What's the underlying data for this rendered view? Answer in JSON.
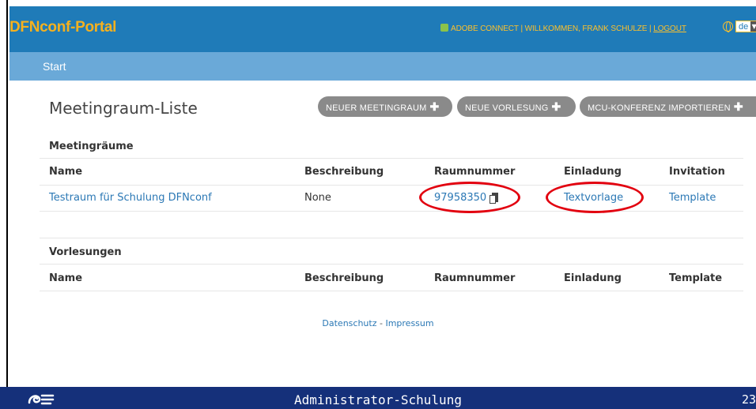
{
  "header": {
    "brand": "DFNconf-Portal",
    "adobe_connect": "ADOBE CONNECT",
    "separator": " | ",
    "welcome": "WILLKOMMEN, FRANK SCHULZE",
    "logout": "LOGOUT",
    "language": "de",
    "colors": {
      "bar": "#1f7bb8",
      "brand": "#f6b11e"
    }
  },
  "subnav": {
    "start": "Start"
  },
  "page": {
    "title": "Meetingraum-Liste",
    "buttons": {
      "new_room": "NEUER MEETINGRAUM",
      "new_lecture": "NEUE VORLESUNG",
      "mcu_import": "MCU-KONFERENZ IMPORTIEREN",
      "plus": "✚"
    }
  },
  "meetingrooms": {
    "title": "Meetingräume",
    "headers": {
      "name": "Name",
      "description": "Beschreibung",
      "room_number": "Raumnummer",
      "invitation": "Einladung",
      "invitation_en": "Invitation"
    },
    "rows": [
      {
        "name": "Testraum für Schulung DFNconf",
        "description": "None",
        "room_number": "97958350",
        "invitation": "Textvorlage",
        "invitation_en": "Template"
      }
    ]
  },
  "lectures": {
    "title": "Vorlesungen",
    "headers": {
      "name": "Name",
      "description": "Beschreibung",
      "room_number": "Raumnummer",
      "invitation": "Einladung",
      "template": "Template"
    }
  },
  "footer": {
    "privacy": "Datenschutz",
    "separator": " - ",
    "imprint": "Impressum"
  },
  "slide": {
    "title": "Administrator-Schulung",
    "number": "23",
    "highlight_color": "#e2000f",
    "bar_color": "#15307a"
  }
}
